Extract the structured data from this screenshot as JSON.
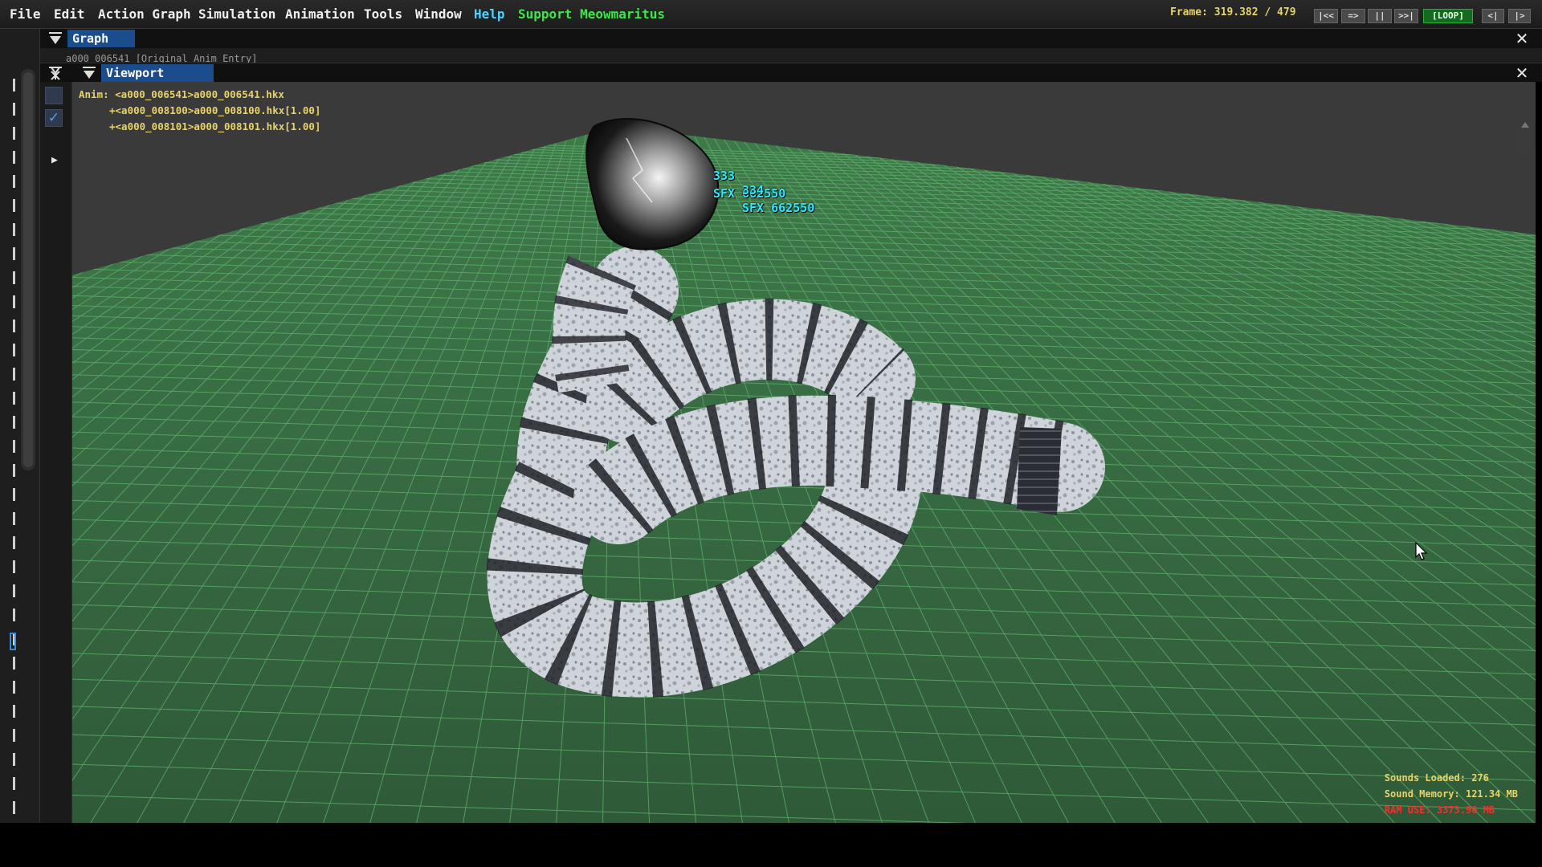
{
  "menu": {
    "items": [
      "File",
      "Edit",
      "Action Graph",
      "Simulation",
      "Animation",
      "Tools",
      "Window",
      "Help",
      "Support Meowmaritus"
    ]
  },
  "playback": {
    "frame_label": "Frame:  319.382 / 479",
    "btn_first": "|<<",
    "btn_prev": "=>",
    "btn_pause": "||",
    "btn_next": ">>|",
    "btn_loop": "[LOOP]",
    "btn_step_back": "<|",
    "btn_step_fwd": "|>"
  },
  "graph_panel": {
    "tab_label": "Graph",
    "partial_text": "a000_006541 [Original Anim Entry]"
  },
  "viewport_panel": {
    "tab_label": "Viewport",
    "anim_info": {
      "line1": "Anim: <a000_006541>a000_006541.hkx",
      "line2": "+<a000_008100>a000_008100.hkx[1.00]",
      "line3": "+<a000_008101>a000_008101.hkx[1.00]"
    },
    "sfx_labels": {
      "a_num": "333",
      "a_sfx": "SFX 662550",
      "b_num": "334",
      "b_sfx": "SFX 662550"
    },
    "stats": {
      "sounds_loaded": "Sounds Loaded: 276",
      "sound_memory": "Sound Memory:  121.34 MB",
      "ram_use": "RAM USE:  3373.96 MB"
    },
    "colors": {
      "ground": "#3b6f45",
      "grid_line": "#5fb36c",
      "sky": "#3a3a3a",
      "label_yellow": "#e8d36a",
      "label_cyan": "#2fe6ff",
      "ram_red": "#ff2a2a"
    }
  },
  "icons": [
    "pin-icon",
    "collapse-icon",
    "close-icon",
    "checkbox-icon",
    "expand-arrow-icon",
    "mouse-cursor-icon"
  ]
}
